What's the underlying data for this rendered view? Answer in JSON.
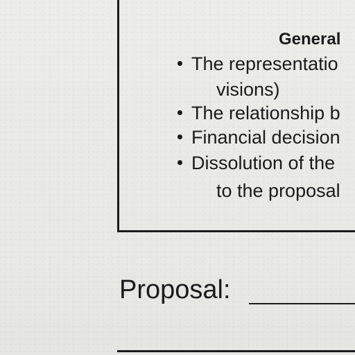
{
  "box": {
    "heading": "General",
    "items": [
      {
        "line1": "The representatio",
        "line2": "visions)"
      },
      {
        "line1": "The relationship b"
      },
      {
        "line1": "Financial decision"
      },
      {
        "line1": "Dissolution of the",
        "line2": "to the proposal"
      }
    ]
  },
  "proposal": {
    "label": "Proposal:"
  }
}
